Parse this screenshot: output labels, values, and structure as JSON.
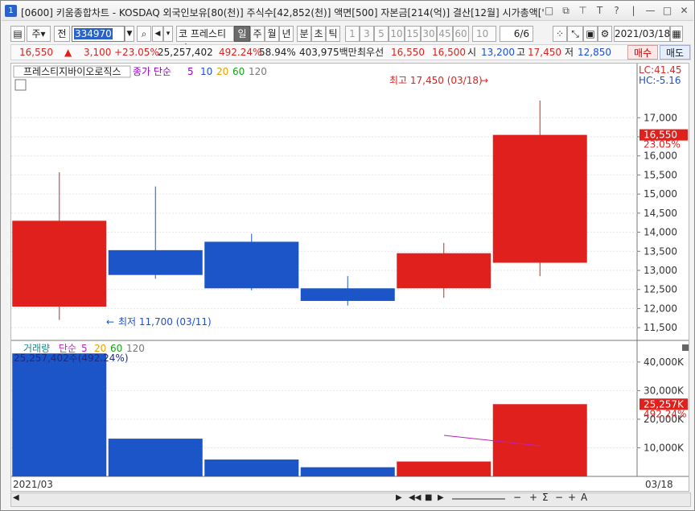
{
  "title": {
    "number": "1",
    "text": "[0600] 키움종합차트 - KOSDAQ 외국인보유[80(천)] 주식수[42,852(천)] 액면[500] 자본금[214(억)] 결산[12월] 시가총액['",
    "buttons": [
      "□",
      "⧉",
      "⊤",
      "T",
      "?",
      "|",
      "—",
      "□",
      "✕"
    ]
  },
  "toolbar": {
    "market": "주",
    "prev": "전",
    "code": "334970",
    "name": "코 프레스티지",
    "periods": [
      "일",
      "주",
      "월",
      "년",
      "분",
      "초",
      "틱"
    ],
    "intervals": [
      "1",
      "3",
      "5",
      "10",
      "15",
      "30",
      "45",
      "60"
    ],
    "count": "10",
    "page": "6/6",
    "date": "2021/03/18"
  },
  "quote": {
    "price": "16,550",
    "change": "3,100",
    "rate": "+23.05%",
    "volume": "25,257,402",
    "vol_rate": "492.24%",
    "turnover": "58.94%",
    "amount": "403,975백만",
    "best_label": "최우선",
    "ask": "16,550",
    "bid": "16,500",
    "open_label": "시",
    "open": "13,200",
    "high_label": "고",
    "high": "17,450",
    "low_label": "저",
    "low": "12,850",
    "buy_label": "매수",
    "sell_label": "매도"
  },
  "price_legend": {
    "name": "프레스티지바이오로직스",
    "ma_label": "종가 단순",
    "ma": [
      "5",
      "10",
      "20",
      "60",
      "120"
    ],
    "colors": [
      "#9900cc",
      "#1c4fd0",
      "#e8a000",
      "#13a013",
      "#777777"
    ]
  },
  "lc_hc": {
    "lc": "LC:41.45",
    "hc": "HC:-5.16"
  },
  "price_axis": [
    "17,000",
    "16,500",
    "16,000",
    "15,500",
    "15,000",
    "14,500",
    "14,000",
    "13,500",
    "13,000",
    "12,500",
    "12,000",
    "11,500"
  ],
  "price_tag": {
    "price": "16,550",
    "rate": "23.05%"
  },
  "annotations": {
    "high": "최고 17,450 (03/18)",
    "low": "최저 11,700 (03/11)"
  },
  "volume_legend": {
    "name": "거래량",
    "ma_label": "단순",
    "ma": [
      "5",
      "20",
      "60",
      "120"
    ],
    "value": "25,257,402주(492.24%)"
  },
  "volume_axis": [
    "40,000K",
    "30,000K",
    "20,000K",
    "10,000K"
  ],
  "volume_tag": {
    "value": "25,257K",
    "rate": "492.24%"
  },
  "x_axis": {
    "start": "2021/03",
    "end": "03/18"
  },
  "chart_data": {
    "type": "candlestick",
    "candles": [
      {
        "o": 14300,
        "h": 15570,
        "l": 11700,
        "c": 12050,
        "color": "#e0201c"
      },
      {
        "o": 13530,
        "h": 15200,
        "l": 12780,
        "c": 12880,
        "color": "#1c55c8"
      },
      {
        "o": 13750,
        "h": 13960,
        "l": 12480,
        "c": 12530,
        "color": "#1c55c8"
      },
      {
        "o": 12530,
        "h": 12850,
        "l": 12080,
        "c": 12200,
        "color": "#1c55c8"
      },
      {
        "o": 12530,
        "h": 13720,
        "l": 12280,
        "c": 13450,
        "color": "#e0201c"
      },
      {
        "o": 13200,
        "h": 17450,
        "l": 12850,
        "c": 16550,
        "color": "#e0201c"
      }
    ],
    "volume": [
      {
        "v": 43000,
        "color": "#1c55c8"
      },
      {
        "v": 13200,
        "color": "#1c55c8"
      },
      {
        "v": 5900,
        "color": "#1c55c8"
      },
      {
        "v": 3200,
        "color": "#1c55c8"
      },
      {
        "v": 5200,
        "color": "#e0201c"
      },
      {
        "v": 25257,
        "color": "#e0201c"
      }
    ],
    "price_range": [
      11250,
      18250
    ],
    "volume_range": [
      0,
      47000
    ]
  }
}
